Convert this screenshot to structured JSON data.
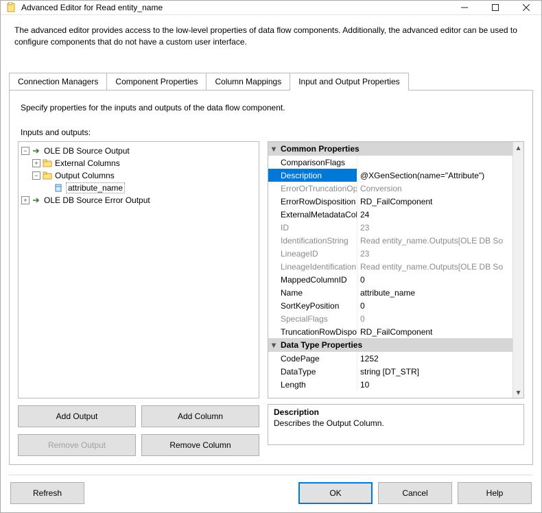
{
  "window": {
    "title": "Advanced Editor for Read entity_name"
  },
  "intro": "The advanced editor provides access to the low-level properties of data flow components. Additionally, the advanced editor can be used to configure components that do not have a custom user interface.",
  "tabs": {
    "items": [
      {
        "label": "Connection Managers"
      },
      {
        "label": "Component Properties"
      },
      {
        "label": "Column Mappings"
      },
      {
        "label": "Input and Output Properties"
      }
    ],
    "active_index": 3,
    "pane_caption": "Specify properties for the inputs and outputs of the data flow component."
  },
  "tree": {
    "heading": "Inputs and outputs:",
    "nodes": {
      "root0": "OLE DB Source Output",
      "ext_cols": "External Columns",
      "out_cols": "Output Columns",
      "attr": "attribute_name",
      "root1": "OLE DB Source Error Output"
    }
  },
  "buttons": {
    "add_output": "Add Output",
    "add_column": "Add Column",
    "remove_output": "Remove Output",
    "remove_column": "Remove Column",
    "refresh": "Refresh",
    "ok": "OK",
    "cancel": "Cancel",
    "help": "Help"
  },
  "propgrid": {
    "sections": [
      {
        "title": "Common Properties",
        "rows": [
          {
            "name": "ComparisonFlags",
            "value": "",
            "gray": false
          },
          {
            "name": "Description",
            "value": "@XGenSection(name=\"Attribute\")",
            "selected": true
          },
          {
            "name": "ErrorOrTruncationOpe",
            "value": "Conversion",
            "gray": true
          },
          {
            "name": "ErrorRowDisposition",
            "value": "RD_FailComponent"
          },
          {
            "name": "ExternalMetadataColu",
            "value": "24"
          },
          {
            "name": "ID",
            "value": "23",
            "gray": true
          },
          {
            "name": "IdentificationString",
            "value": "Read entity_name.Outputs[OLE DB So",
            "gray": true
          },
          {
            "name": "LineageID",
            "value": "23",
            "gray": true
          },
          {
            "name": "LineageIdentificationS",
            "value": "Read entity_name.Outputs[OLE DB So",
            "gray": true
          },
          {
            "name": "MappedColumnID",
            "value": "0"
          },
          {
            "name": "Name",
            "value": "attribute_name"
          },
          {
            "name": "SortKeyPosition",
            "value": "0"
          },
          {
            "name": "SpecialFlags",
            "value": "0",
            "gray": true
          },
          {
            "name": "TruncationRowDisposi",
            "value": "RD_FailComponent"
          }
        ]
      },
      {
        "title": "Data Type Properties",
        "rows": [
          {
            "name": "CodePage",
            "value": "1252"
          },
          {
            "name": "DataType",
            "value": "string [DT_STR]"
          },
          {
            "name": "Length",
            "value": "10"
          }
        ]
      }
    ],
    "description": {
      "heading": "Description",
      "text": "Describes the Output Column."
    }
  }
}
